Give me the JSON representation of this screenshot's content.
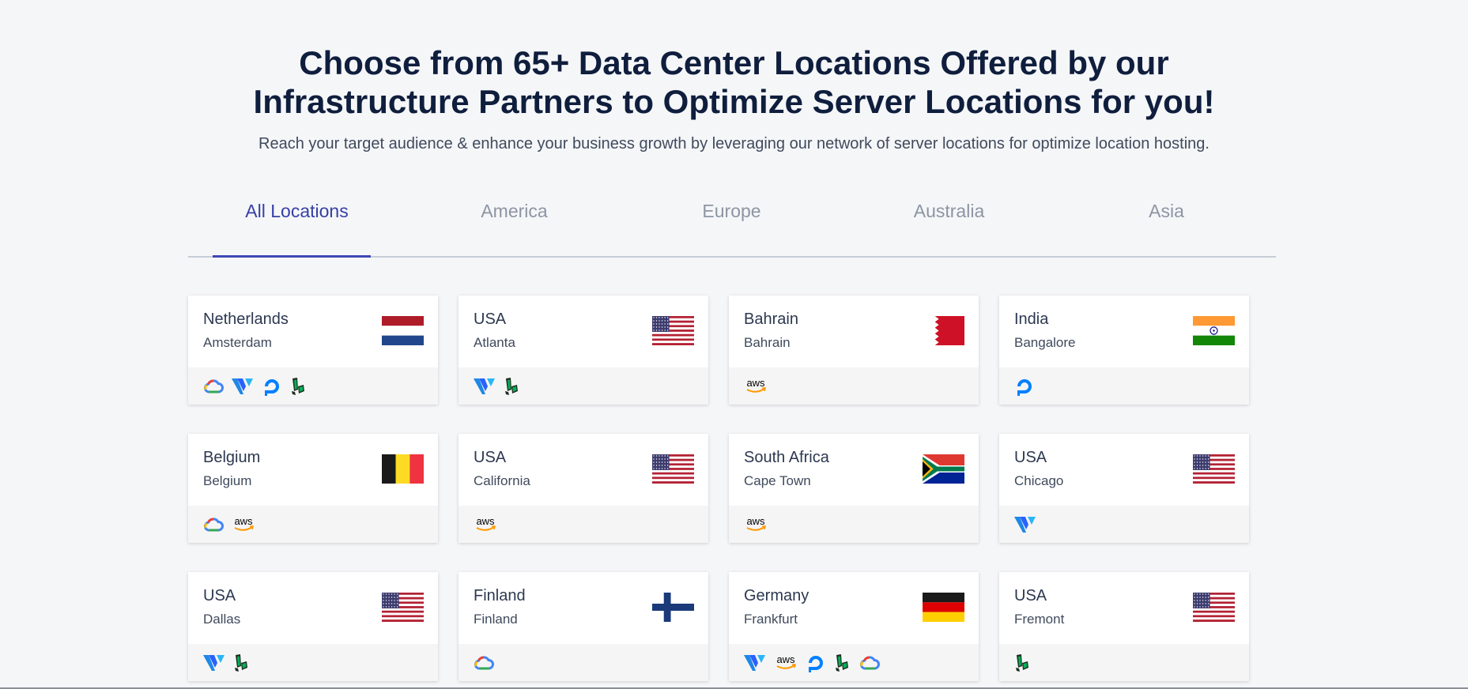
{
  "header": {
    "title_line1": "Choose from 65+ Data Center Locations Offered by our",
    "title_line2": "Infrastructure Partners to Optimize Server Locations for you!",
    "subtitle": "Reach your target audience & enhance your business growth by leveraging our network of server locations for optimize location hosting."
  },
  "tabs": [
    {
      "label": "All Locations",
      "active": true
    },
    {
      "label": "America",
      "active": false
    },
    {
      "label": "Europe",
      "active": false
    },
    {
      "label": "Australia",
      "active": false
    },
    {
      "label": "Asia",
      "active": false
    }
  ],
  "provider_labels": {
    "aws": "aws"
  },
  "locations": [
    {
      "country": "Netherlands",
      "city": "Amsterdam",
      "flag": "nl",
      "providers": [
        "google-cloud",
        "vultr",
        "digitalocean",
        "linode"
      ]
    },
    {
      "country": "USA",
      "city": "Atlanta",
      "flag": "us",
      "providers": [
        "vultr",
        "linode"
      ]
    },
    {
      "country": "Bahrain",
      "city": "Bahrain",
      "flag": "bh",
      "providers": [
        "aws"
      ]
    },
    {
      "country": "India",
      "city": "Bangalore",
      "flag": "in",
      "providers": [
        "digitalocean"
      ]
    },
    {
      "country": "Belgium",
      "city": "Belgium",
      "flag": "be",
      "providers": [
        "google-cloud",
        "aws"
      ]
    },
    {
      "country": "USA",
      "city": "California",
      "flag": "us",
      "providers": [
        "aws"
      ]
    },
    {
      "country": "South Africa",
      "city": "Cape Town",
      "flag": "za",
      "providers": [
        "aws"
      ]
    },
    {
      "country": "USA",
      "city": "Chicago",
      "flag": "us",
      "providers": [
        "vultr"
      ]
    },
    {
      "country": "USA",
      "city": "Dallas",
      "flag": "us",
      "providers": [
        "vultr",
        "linode"
      ]
    },
    {
      "country": "Finland",
      "city": "Finland",
      "flag": "fi",
      "providers": [
        "google-cloud"
      ]
    },
    {
      "country": "Germany",
      "city": "Frankfurt",
      "flag": "de",
      "providers": [
        "vultr",
        "aws",
        "digitalocean",
        "linode",
        "google-cloud"
      ]
    },
    {
      "country": "USA",
      "city": "Fremont",
      "flag": "us",
      "providers": [
        "linode"
      ]
    }
  ]
}
